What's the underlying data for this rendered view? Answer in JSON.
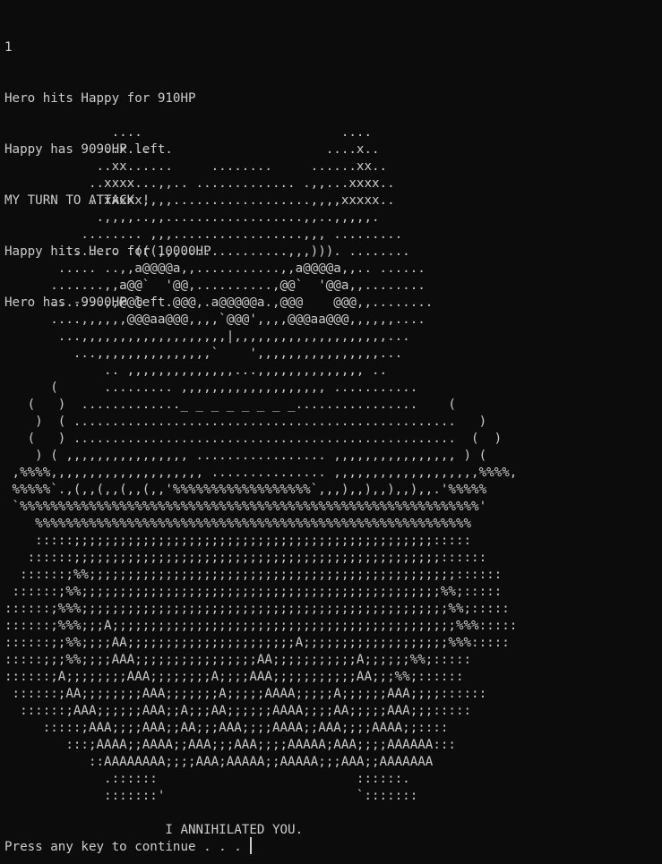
{
  "log": [
    "1",
    "Hero hits Happy for 910HP",
    "Happy has 9090HP left.",
    "MY TURN TO ATTACK !",
    "Happy hits Hero for 10000HP",
    "Hero has -9900HP left."
  ],
  "art": [
    "              ....                          ....",
    "             ..x....                      ....x..",
    "            ..xx......     ........     ......xx..",
    "           ..xxxx...,,.. ............. .,,...xxxx..",
    "           ..xxxxx,,,,..................,,,,xxxxx..",
    "            .,,,,..,,..................,,..,,,,,.",
    "          ........ ,,,.................,,, .........",
    "        ....... .(((,,,..............,,,))). ........",
    "       ..... ..,,a@@@@a,,...........,,a@@@@a,,.. ......",
    "      .......,,a@@`  '@@,..........,@@`  '@@a,,........",
    "      .......,,@@@    @@@,.a@@@@@a.,@@@    @@@,,........",
    "      ....,,,,,,@@@aa@@@,,,,`@@@',,,,@@@aa@@@,,,,,,....",
    "       ...,,,,,,,,,,,,,,,,,,,|,,,,,,,,,,,,,,,,,,,,...",
    "         ...,,,,,,,,,,,,,,,`    ',,,,,,,,,,,,,,,,...",
    "             .. ,,,,,,,,,,,,,,...,,,,,,,,,,,,,, ..",
    "      (      ......... ,,,,,,,,,,,,,,,,,,, ...........",
    "   (   )  ............._ _ _ _ _ _ _ _................    (",
    "    )  ( ..................................................   )",
    "   (   ) ..................................................  (  )",
    "    ) ( ,,,,,,,,,,,,,,,, ................. ,,,,,,,,,,,,,,,, ) (",
    " ,%%%%,,,,,,,,,,,,,,,,,,,, ............... ,,,,,,,,,,,,,,,,,,,%%%%,",
    " %%%%%`.,(,,(,,(,,(,,'%%%%%%%%%%%%%%%%%%`,,,),,),,),,),,.'%%%%%",
    " `%%%%%%%%%%%%%%%%%%%%%%%%%%%%%%%%%%%%%%%%%%%%%%%%%%%%%%%%%%%%'",
    "    %%%%%%%%%%%%%%%%%%%%%%%%%%%%%%%%%%%%%%%%%%%%%%%%%%%%%%%%%",
    "    :::::;;;;;;;;;;;;;;;;;;;;;;;;;;;;;;;;;;;;;;;;;;;;;;;:::::",
    "   ::::::;;;;;;;;;;;;;;;;;;;;;;;;;;;;;;;;;;;;;;;;;;;;;;;;::::::",
    "  ::::::;%%;;;;;;;;;;;;;;;;;;;;;;;;;;;;;;;;;;;;;;;;;;;;;;;;::::::",
    " ::::::;%%;;;;;;;;;;;;;;;;;;;;;;;;;;;;;;;;;;;;;;;;;;;;;;;%%;:::::",
    "::::::;%%%;;;;;;;;;;;;;;;;;;;;;;;;;;;;;;;;;;;;;;;;;;;;;;;;%%;:::::",
    "::::::;%%%;;;A;;;;;;;;;;;;;;;;;;;;;;;;;;;;;;;;;;;;;;;;;;;;;%%%:::::",
    "::::::;;%%;;;;AA;;;;;;;;;;;;;;;;;;;;;;A;;;;;;;;;;;;;;;;;;;%%%:::::",
    ":::::;;;%%;;;;AAA;;;;;;;;;;;;;;;;AA;;;;;;;;;;;A;;;;;;%%;:::::",
    "::::::;A;;;;;;;;AAA;;;;;;;;A;;;;AAA;;;;;;;;;;;AA;;;%%;::::::",
    " ::::::;AA;;;;;;;;AAA;;;;;;;A;;;;;AAAA;;;;;A;;;;;;AAA;;;;::::::",
    "  ::::::;AAA;;;;;;AAA;;A;;;AA;;;;;;AAAA;;;;AA;;;;;AAA;;;:::::",
    "     :::::;AAA;;;;AAA;;AA;;;AAA;;;;AAAA;;AAA;;;;AAAA;;::::",
    "        :::;AAAA;;AAAA;;AAA;;;AAA;;;;AAAAA;AAA;;;;AAAAAA:::",
    "           ::AAAAAAAA;;;;AAA;AAAAA;;AAAAA;;;AAA;;AAAAAAA",
    "             .::::::                          ::::::.",
    "             :::::::'                         `:::::::",
    "",
    "                     I ANNIHILATED YOU."
  ],
  "prompt": "Press any key to continue . . . "
}
